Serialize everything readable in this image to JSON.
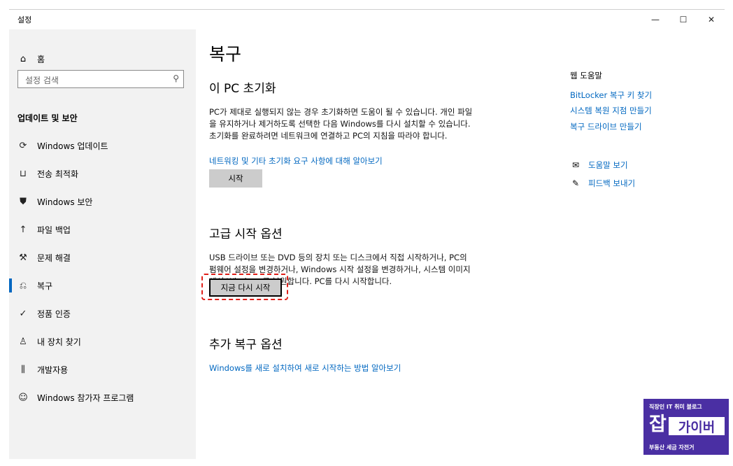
{
  "window": {
    "title": "설정",
    "minimize": "—",
    "maximize": "☐",
    "close": "✕"
  },
  "sidebar": {
    "home_label": "홈",
    "search_placeholder": "설정 검색",
    "section_title": "업데이트 및 보안",
    "items": [
      {
        "label": "Windows 업데이트",
        "icon": "sync-icon"
      },
      {
        "label": "전송 최적화",
        "icon": "delivery-icon"
      },
      {
        "label": "Windows 보안",
        "icon": "shield-icon"
      },
      {
        "label": "파일 백업",
        "icon": "backup-icon"
      },
      {
        "label": "문제 해결",
        "icon": "wrench-icon"
      },
      {
        "label": "복구",
        "icon": "recovery-icon"
      },
      {
        "label": "정품 인증",
        "icon": "check-circle-icon"
      },
      {
        "label": "내 장치 찾기",
        "icon": "person-pin-icon"
      },
      {
        "label": "개발자용",
        "icon": "developer-icon"
      },
      {
        "label": "Windows 참가자 프로그램",
        "icon": "insider-icon"
      }
    ]
  },
  "main": {
    "title": "복구",
    "reset": {
      "heading": "이 PC 초기화",
      "text": "PC가 제대로 실행되지 않는 경우 초기화하면 도움이 될 수 있습니다. 개인 파일을 유지하거나 제거하도록 선택한 다음 Windows를 다시 설치할 수 있습니다. 초기화를 완료하려면 네트워크에 연결하고 PC의 지침을 따라야 합니다.",
      "link": "네트워킹 및 기타 초기화 요구 사항에 대해 알아보기",
      "button": "시작"
    },
    "advanced": {
      "heading": "고급 시작 옵션",
      "text": "USB 드라이브 또는 DVD 등의 장치 또는 디스크에서 직접 시작하거나, PC의 펌웨어 설정을 변경하거나, Windows 시작 설정을 변경하거나, 시스템 이미지에서 Windows를 복원합니다. PC를 다시 시작합니다.",
      "button": "지금 다시 시작"
    },
    "more": {
      "heading": "추가 복구 옵션",
      "link": "Windows를 새로 설치하여 새로 시작하는 방법 알아보기"
    }
  },
  "right": {
    "help_title": "웹 도움말",
    "links": [
      "BitLocker 복구 키 찾기",
      "시스템 복원 지점 만들기",
      "복구 드라이브 만들기"
    ],
    "get_help": "도움말 보기",
    "feedback": "피드백 보내기"
  },
  "watermark": {
    "top": "직장인 IT 취미 블로그",
    "big": "잡",
    "sub": "가이버",
    "bottom": "부동산 세금 자전거"
  },
  "colors": {
    "accent": "#0067c0",
    "sidebar_bg": "#f2f2f2",
    "highlight": "#e0201a",
    "watermark_bg": "#4a2fa3"
  }
}
